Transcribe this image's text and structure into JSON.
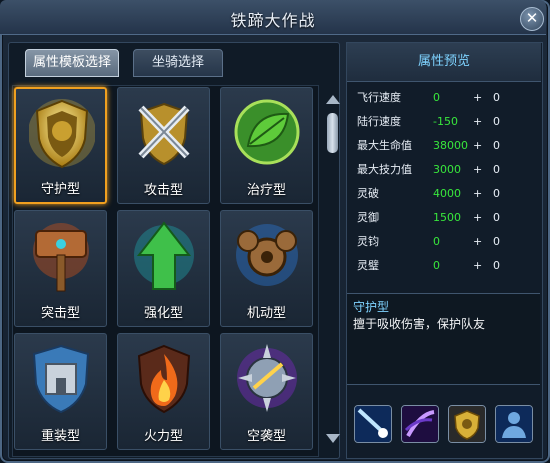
{
  "window": {
    "title": "铁蹄大作战",
    "close_label": "✕"
  },
  "tabs": [
    {
      "label": "属性模板选择",
      "active": true
    },
    {
      "label": "坐骑选择",
      "active": false
    }
  ],
  "templates": [
    {
      "label": "守护型",
      "icon": "guardian-shield-icon",
      "selected": true
    },
    {
      "label": "攻击型",
      "icon": "crossed-swords-icon",
      "selected": false
    },
    {
      "label": "治疗型",
      "icon": "leaf-shield-icon",
      "selected": false
    },
    {
      "label": "突击型",
      "icon": "warhammer-icon",
      "selected": false
    },
    {
      "label": "强化型",
      "icon": "up-arrow-icon",
      "selected": false
    },
    {
      "label": "机动型",
      "icon": "gears-icon",
      "selected": false
    },
    {
      "label": "重装型",
      "icon": "fortress-shield-icon",
      "selected": false
    },
    {
      "label": "火力型",
      "icon": "flame-icon",
      "selected": false
    },
    {
      "label": "空袭型",
      "icon": "spiked-orb-icon",
      "selected": false
    }
  ],
  "preview": {
    "title": "属性预览",
    "stats": [
      {
        "name": "飞行速度",
        "value": "0",
        "plus": "+",
        "bonus": "0"
      },
      {
        "name": "陆行速度",
        "value": "-150",
        "plus": "+",
        "bonus": "0"
      },
      {
        "name": "最大生命值",
        "value": "38000",
        "plus": "+",
        "bonus": "0"
      },
      {
        "name": "最大技力值",
        "value": "3000",
        "plus": "+",
        "bonus": "0"
      },
      {
        "name": "灵破",
        "value": "4000",
        "plus": "+",
        "bonus": "0"
      },
      {
        "name": "灵御",
        "value": "1500",
        "plus": "+",
        "bonus": "0"
      },
      {
        "name": "灵钧",
        "value": "0",
        "plus": "+",
        "bonus": "0"
      },
      {
        "name": "灵璧",
        "value": "0",
        "plus": "+",
        "bonus": "0"
      }
    ],
    "description_title": "守护型",
    "description": "擅于吸收伤害，保护队友"
  },
  "skills": [
    {
      "icon": "comet-strike-icon"
    },
    {
      "icon": "purple-slash-icon"
    },
    {
      "icon": "gold-shield-icon"
    },
    {
      "icon": "silhouette-icon"
    }
  ],
  "colors": {
    "accent": "#f0a020",
    "stat_value": "#38e63c",
    "highlight": "#7fd3ff"
  }
}
